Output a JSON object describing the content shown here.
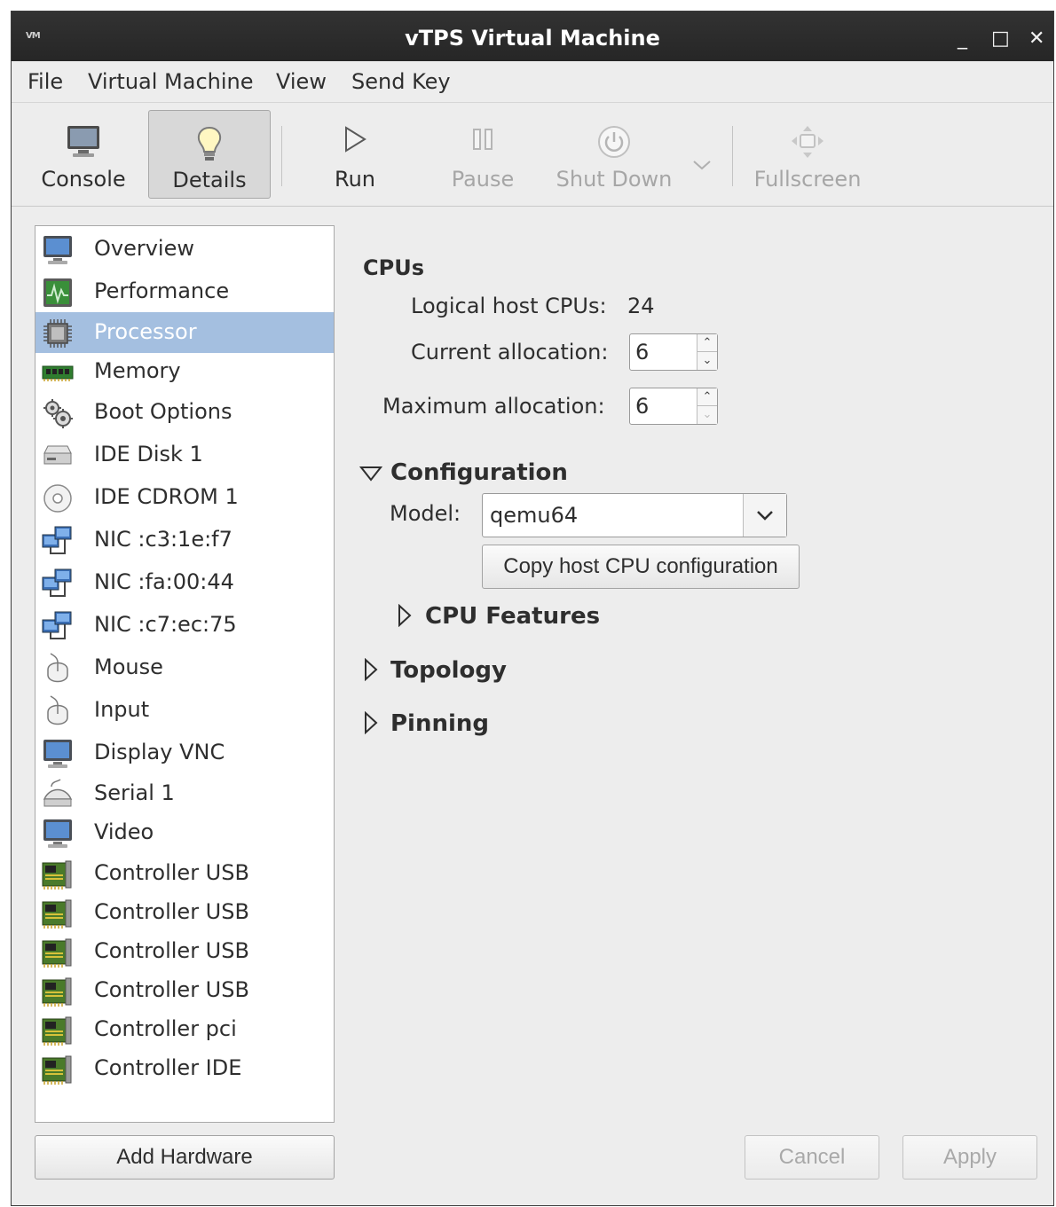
{
  "window": {
    "title": "vTPS Virtual Machine",
    "app_icon_text": "VM",
    "controls": {
      "minimize": "_",
      "maximize": "□",
      "close": "✕"
    }
  },
  "menu": [
    "File",
    "Virtual Machine",
    "View",
    "Send Key"
  ],
  "toolbar": {
    "console": "Console",
    "details": "Details",
    "run": "Run",
    "pause": "Pause",
    "shutdown": "Shut Down",
    "fullscreen": "Fullscreen"
  },
  "sidebar": {
    "selected_index": 2,
    "items": [
      {
        "label": "Overview",
        "icon": "monitor-icon"
      },
      {
        "label": "Performance",
        "icon": "performance-icon"
      },
      {
        "label": "Processor",
        "icon": "cpu-chip-icon"
      },
      {
        "label": "Memory",
        "icon": "memory-icon"
      },
      {
        "label": "Boot Options",
        "icon": "gears-icon"
      },
      {
        "label": "IDE Disk 1",
        "icon": "disk-icon"
      },
      {
        "label": "IDE CDROM 1",
        "icon": "cdrom-icon"
      },
      {
        "label": "NIC :c3:1e:f7",
        "icon": "network-icon"
      },
      {
        "label": "NIC :fa:00:44",
        "icon": "network-icon"
      },
      {
        "label": "NIC :c7:ec:75",
        "icon": "network-icon"
      },
      {
        "label": "Mouse",
        "icon": "mouse-icon"
      },
      {
        "label": "Input",
        "icon": "mouse-icon"
      },
      {
        "label": "Display VNC",
        "icon": "monitor-icon"
      },
      {
        "label": "Serial 1",
        "icon": "serial-icon"
      },
      {
        "label": "Video",
        "icon": "monitor-icon"
      },
      {
        "label": "Controller USB",
        "icon": "controller-card-icon"
      },
      {
        "label": "Controller USB",
        "icon": "controller-card-icon"
      },
      {
        "label": "Controller USB",
        "icon": "controller-card-icon"
      },
      {
        "label": "Controller USB",
        "icon": "controller-card-icon"
      },
      {
        "label": "Controller pci",
        "icon": "controller-card-icon"
      },
      {
        "label": "Controller IDE",
        "icon": "controller-card-icon"
      }
    ],
    "add_hardware": "Add Hardware"
  },
  "cpus": {
    "heading": "CPUs",
    "logical_label": "Logical host CPUs:",
    "logical_value": "24",
    "current_label": "Current allocation:",
    "current_value": "6",
    "max_label": "Maximum allocation:",
    "max_value": "6"
  },
  "configuration": {
    "heading": "Configuration",
    "model_label": "Model:",
    "model_value": "qemu64",
    "copy_button": "Copy host CPU configuration",
    "cpu_features": "CPU Features"
  },
  "topology": "Topology",
  "pinning": "Pinning",
  "footer": {
    "cancel": "Cancel",
    "apply": "Apply"
  }
}
